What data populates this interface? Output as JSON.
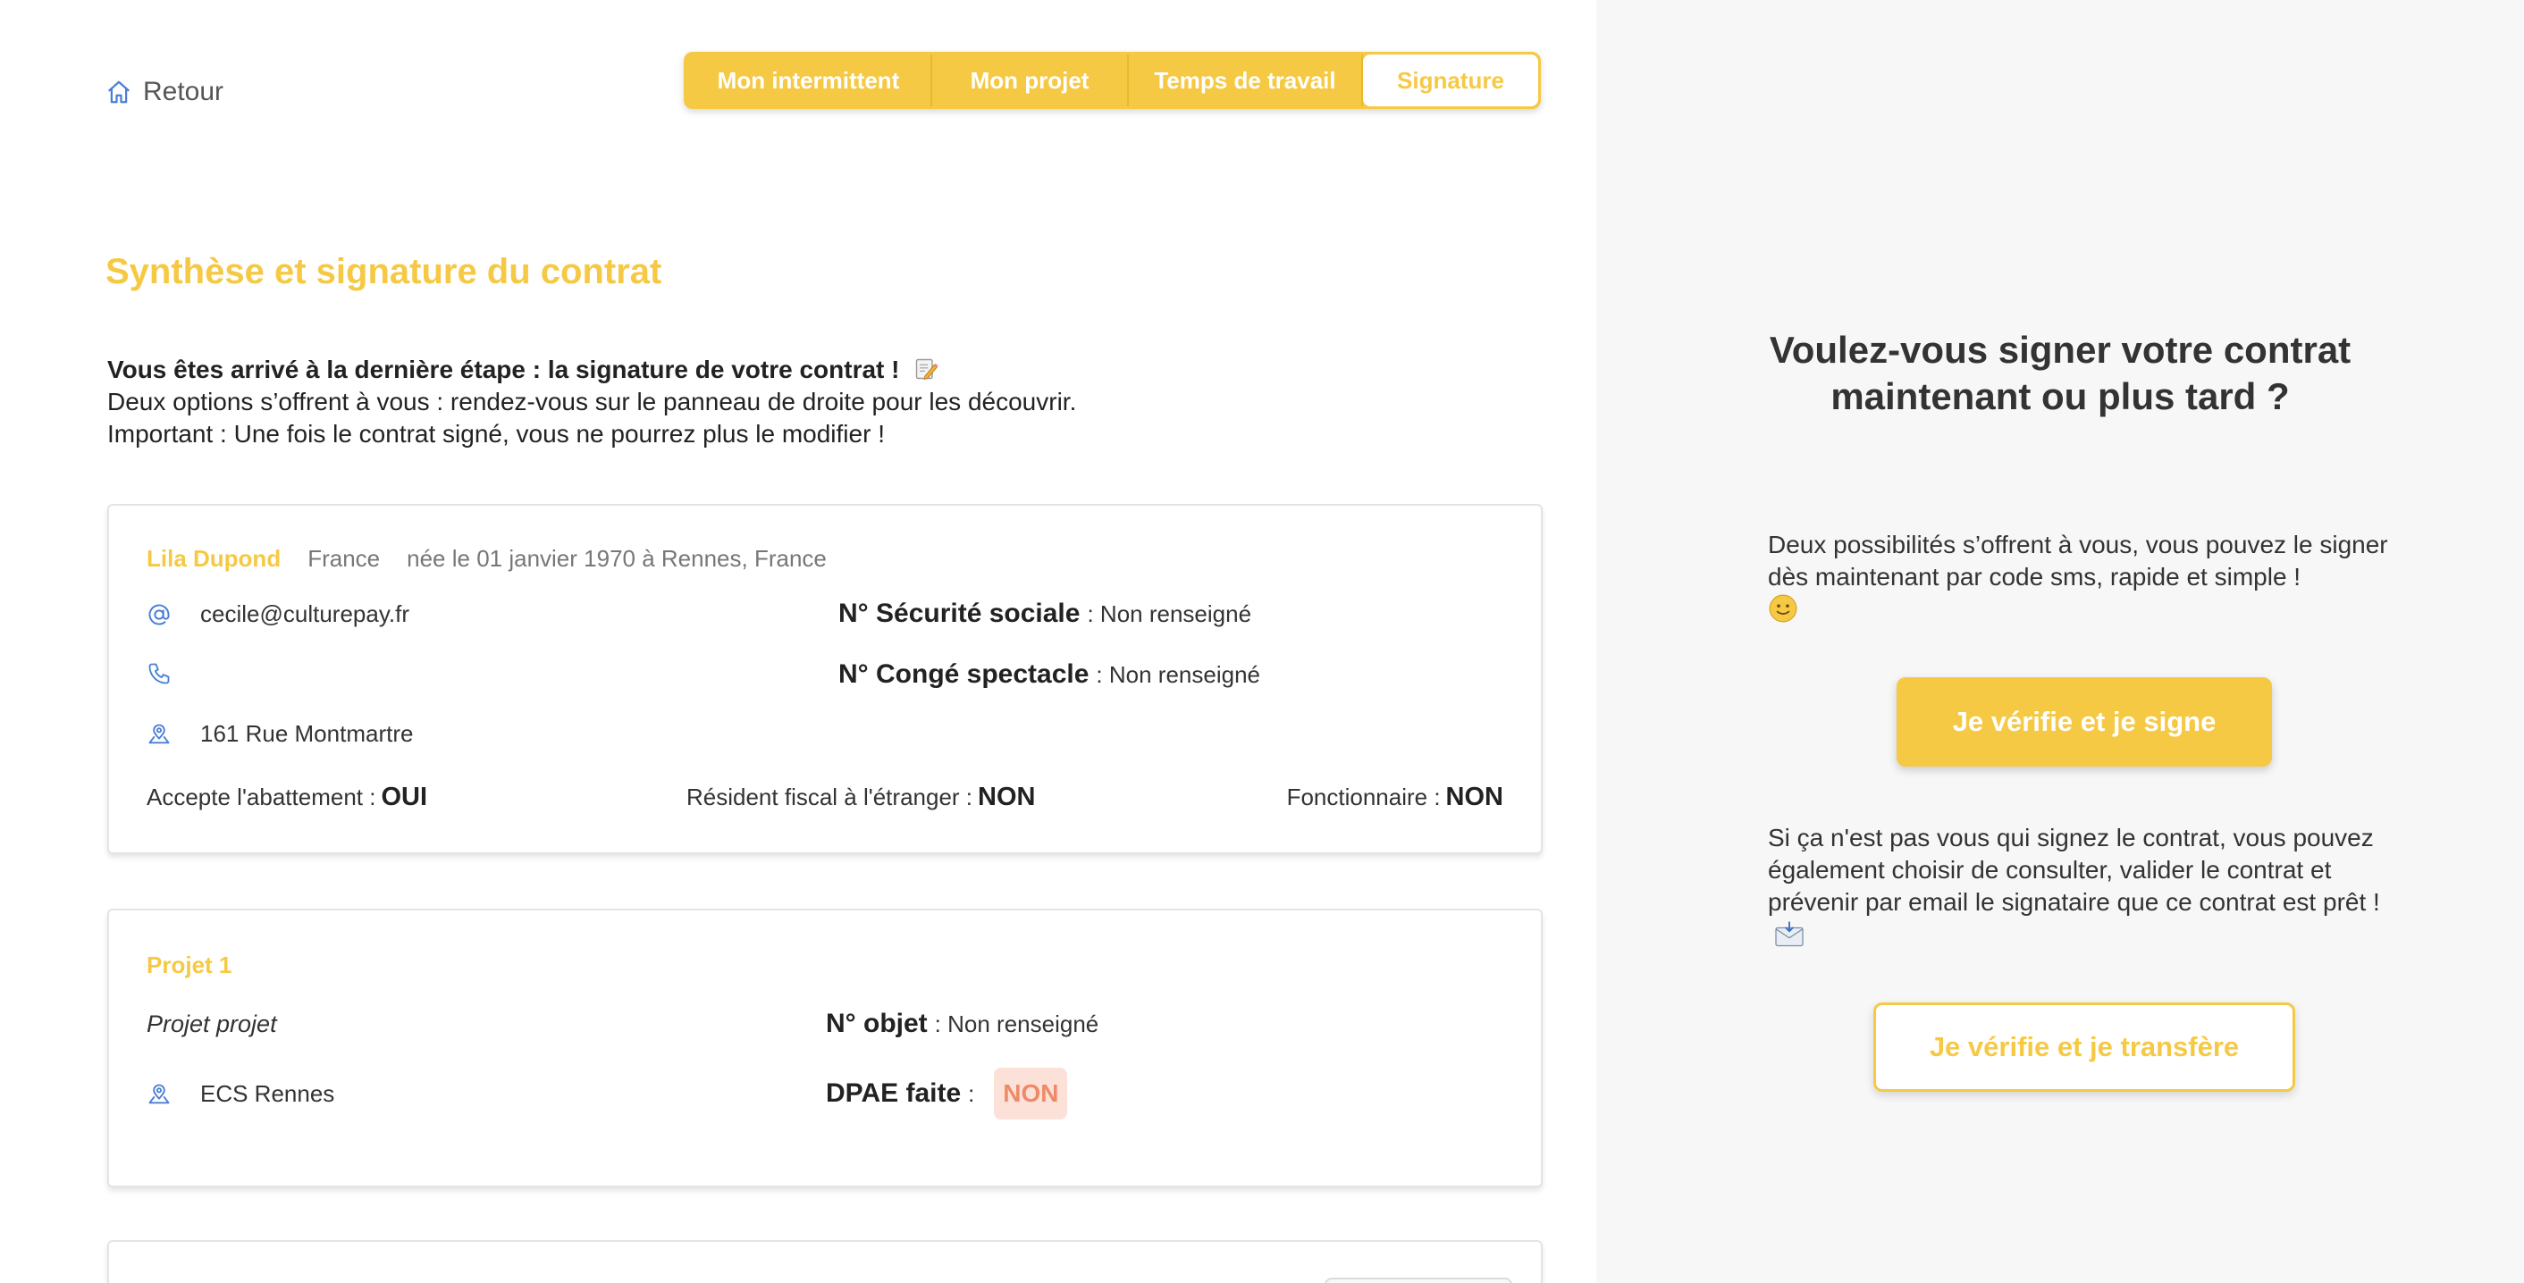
{
  "nav": {
    "back_label": "Retour",
    "steps": [
      {
        "label": "Mon intermittent"
      },
      {
        "label": "Mon projet"
      },
      {
        "label": "Temps de travail"
      },
      {
        "label": "Signature"
      }
    ]
  },
  "main": {
    "title": "Synthèse et signature du contrat",
    "intro_bold": "Vous êtes arrivé à la dernière étape : la signature de votre contrat !",
    "intro_line2": "Deux options s’offrent à vous : rendez-vous sur le panneau de droite pour les découvrir.",
    "intro_line3": "Important : Une fois le contrat signé, vous ne pourrez plus le modifier !"
  },
  "person": {
    "name": "Lila Dupond",
    "country": "France",
    "birth": "née le 01 janvier 1970 à Rennes, France",
    "email": "cecile@culturepay.fr",
    "phone": "",
    "address": "161 Rue Montmartre",
    "secu_label": "N° Sécurité sociale",
    "secu_value": ": Non renseigné",
    "conge_label": "N° Congé spectacle",
    "conge_value": ": Non renseigné",
    "abattement_label": "Accepte l'abattement :",
    "abattement_value": "OUI",
    "resident_label": "Résident fiscal à l'étranger :",
    "resident_value": "NON",
    "fonctionnaire_label": "Fonctionnaire :",
    "fonctionnaire_value": "NON"
  },
  "project": {
    "title": "Projet 1",
    "name": "Projet projet",
    "location": "ECS Rennes",
    "objet_label": "N° objet",
    "objet_value": ": Non renseigné",
    "dpae_label": "DPAE faite",
    "dpae_sep": ":",
    "dpae_value": "NON"
  },
  "side": {
    "title_line1": "Voulez-vous signer votre contrat",
    "title_line2": "maintenant ou plus tard ?",
    "text1": "Deux possibilités s’offrent à vous, vous pouvez le signer dès maintenant par code sms, rapide et simple !",
    "sign_button": "Je vérifie et je signe",
    "text2": "Si ça n'est pas vous qui signez le contrat, vous pouvez également choisir de consulter, valider le contrat et prévenir par email le signataire que ce contrat est prêt !",
    "transfer_button": "Je vérifie et je transfère"
  },
  "icons": {
    "back": "home-icon",
    "email": "at-icon",
    "phone": "phone-icon",
    "address": "location-pin-icon",
    "intro": "memo-pencil-icon",
    "smile": "slightly-smiling-face-icon",
    "mail": "incoming-envelope-icon"
  },
  "colors": {
    "accent": "#f6c944",
    "icon_blue": "#4a7fd6",
    "danger_bg": "#fbe1d8",
    "danger_text": "#ef8a68",
    "side_bg": "#f7f7f7"
  }
}
